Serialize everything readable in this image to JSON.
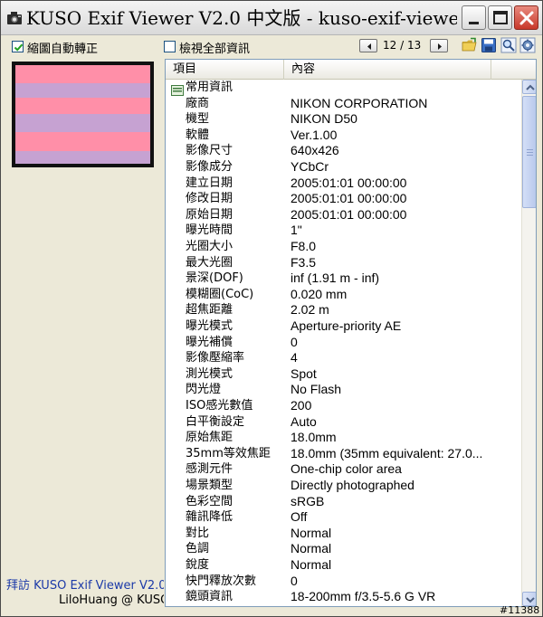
{
  "window": {
    "title": "KUSO Exif Viewer V2.0 中文版 - kuso-exif-viewe...",
    "minimize_icon": "minimize-icon",
    "maximize_icon": "maximize-icon",
    "close_icon": "close-icon",
    "close_color": "#c8382a"
  },
  "left_panel": {
    "auto_rotate_label": "縮圖自動轉正",
    "auto_rotate_checked": true,
    "thumbnail_colors": [
      "#ff8fa8",
      "#c6a2d2"
    ],
    "credit_line1": "拜訪 KUSO Exif Viewer V2.0",
    "credit_line2": "LiloHuang @ KUSO"
  },
  "toolbar": {
    "show_all_label": "檢視全部資訊",
    "show_all_checked": false,
    "prev_icon": "prev-arrow-icon",
    "next_icon": "next-arrow-icon",
    "page_current": 12,
    "page_total": 13,
    "page_text": "12 / 13",
    "tools": [
      "open-folder-icon",
      "save-icon",
      "search-icon",
      "settings-icon"
    ]
  },
  "table": {
    "headers": {
      "item": "項目",
      "content": "內容"
    },
    "group_label": "常用資訊",
    "group_icon": "exif-group-icon",
    "rows": [
      {
        "item": "廠商",
        "value": "NIKON CORPORATION"
      },
      {
        "item": "機型",
        "value": "NIKON D50"
      },
      {
        "item": "軟體",
        "value": "Ver.1.00"
      },
      {
        "item": "影像尺寸",
        "value": "640x426"
      },
      {
        "item": "影像成分",
        "value": "YCbCr"
      },
      {
        "item": "建立日期",
        "value": "2005:01:01 00:00:00"
      },
      {
        "item": "修改日期",
        "value": "2005:01:01 00:00:00"
      },
      {
        "item": "原始日期",
        "value": "2005:01:01 00:00:00"
      },
      {
        "item": "曝光時間",
        "value": "1\""
      },
      {
        "item": "光圈大小",
        "value": "F8.0"
      },
      {
        "item": "最大光圈",
        "value": "F3.5"
      },
      {
        "item": "景深(DOF)",
        "value": "inf (1.91 m - inf)"
      },
      {
        "item": "模糊圈(CoC)",
        "value": "0.020 mm"
      },
      {
        "item": "超焦距離",
        "value": "2.02 m"
      },
      {
        "item": "曝光模式",
        "value": "Aperture-priority AE"
      },
      {
        "item": "曝光補償",
        "value": "0"
      },
      {
        "item": "影像壓縮率",
        "value": "4"
      },
      {
        "item": "測光模式",
        "value": "Spot"
      },
      {
        "item": "閃光燈",
        "value": "No Flash"
      },
      {
        "item": "ISO感光數值",
        "value": "200"
      },
      {
        "item": "白平衡設定",
        "value": "Auto"
      },
      {
        "item": "原始焦距",
        "value": "18.0mm"
      },
      {
        "item": "35mm等效焦距",
        "value": "18.0mm (35mm equivalent: 27.0..."
      },
      {
        "item": "感測元件",
        "value": "One-chip color area"
      },
      {
        "item": "場景類型",
        "value": "Directly photographed"
      },
      {
        "item": "色彩空間",
        "value": "sRGB"
      },
      {
        "item": "雜訊降低",
        "value": "Off"
      },
      {
        "item": "對比",
        "value": "Normal"
      },
      {
        "item": "色調",
        "value": "Normal"
      },
      {
        "item": "銳度",
        "value": "Normal"
      },
      {
        "item": "快門釋放次數",
        "value": "0"
      },
      {
        "item": "鏡頭資訊",
        "value": "18-200mm f/3.5-5.6 G VR"
      }
    ]
  },
  "watermark": "#11388"
}
